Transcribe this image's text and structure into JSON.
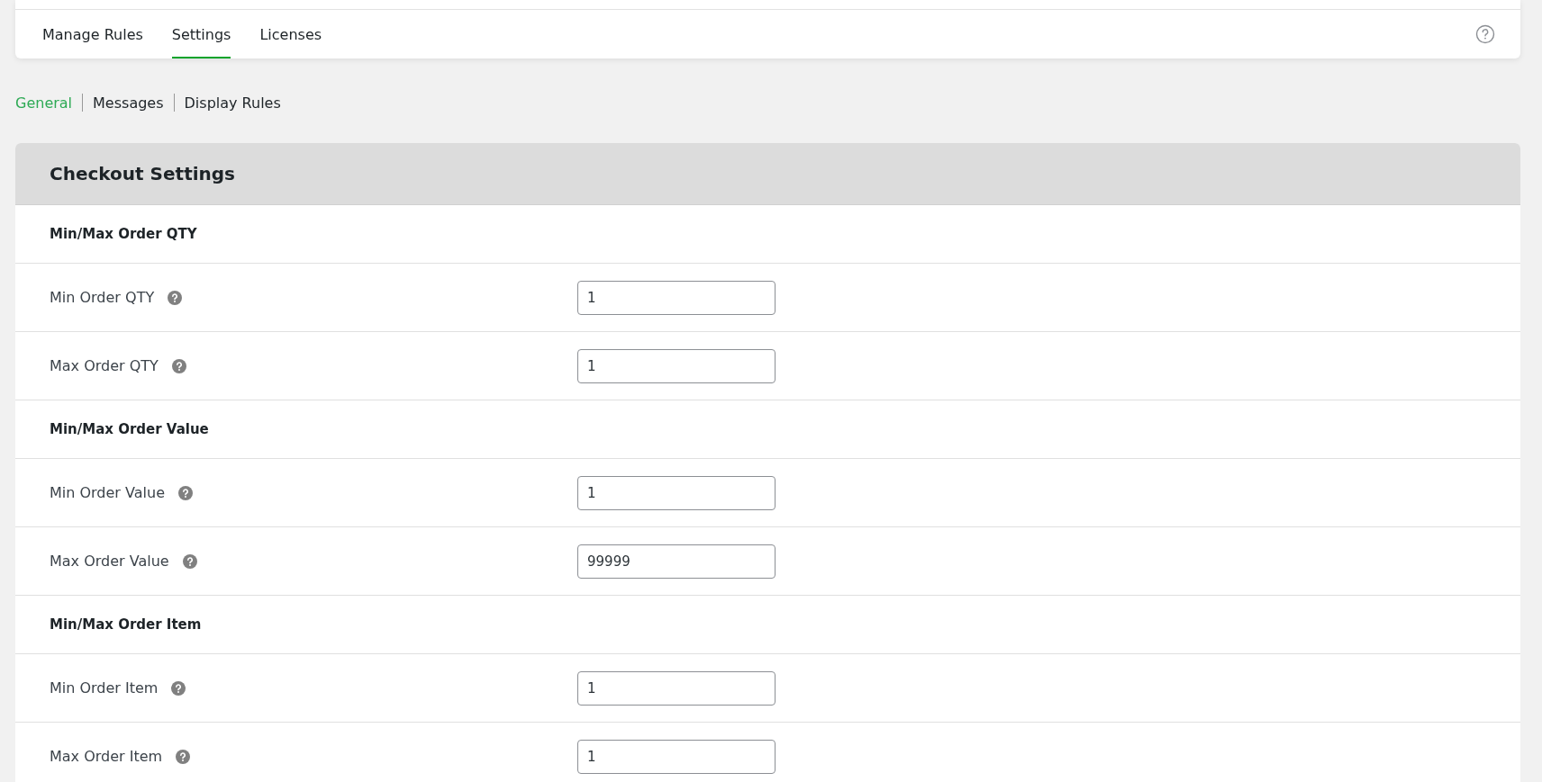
{
  "tabs": [
    {
      "label": "Manage Rules",
      "selected": false
    },
    {
      "label": "Settings",
      "selected": true
    },
    {
      "label": "Licenses",
      "selected": false
    }
  ],
  "subtabs": [
    {
      "label": "General",
      "selected": true
    },
    {
      "label": "Messages",
      "selected": false
    },
    {
      "label": "Display Rules",
      "selected": false
    }
  ],
  "panel": {
    "title": "Checkout Settings",
    "rows": [
      {
        "kind": "group",
        "label": "Min/Max Order QTY"
      },
      {
        "kind": "field",
        "label": "Min Order QTY",
        "value": "1"
      },
      {
        "kind": "field",
        "label": "Max Order QTY",
        "value": "1"
      },
      {
        "kind": "group",
        "label": "Min/Max Order Value"
      },
      {
        "kind": "field",
        "label": "Min Order Value",
        "value": "1"
      },
      {
        "kind": "field",
        "label": "Max Order Value",
        "value": "99999"
      },
      {
        "kind": "group",
        "label": "Min/Max Order Item"
      },
      {
        "kind": "field",
        "label": "Min Order Item",
        "value": "1"
      },
      {
        "kind": "field",
        "label": "Max Order Item",
        "value": "1"
      }
    ]
  }
}
